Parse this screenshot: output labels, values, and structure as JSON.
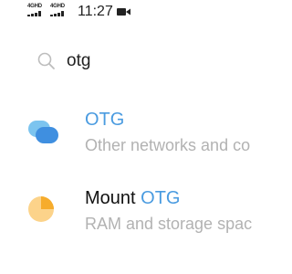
{
  "status_bar": {
    "network_1": "4GHD",
    "network_2": "4GHD",
    "time": "11:27"
  },
  "search": {
    "query": "otg",
    "icon": "search-icon"
  },
  "results": [
    {
      "icon": "otg-icon",
      "title_prefix": "",
      "title_highlight": "OTG",
      "subtitle": "Other networks and co"
    },
    {
      "icon": "storage-icon",
      "title_prefix": "Mount ",
      "title_highlight": "OTG",
      "subtitle": "RAM and storage spac"
    }
  ],
  "colors": {
    "highlight": "#4a9be0",
    "subtitle": "#b2b2b2"
  }
}
